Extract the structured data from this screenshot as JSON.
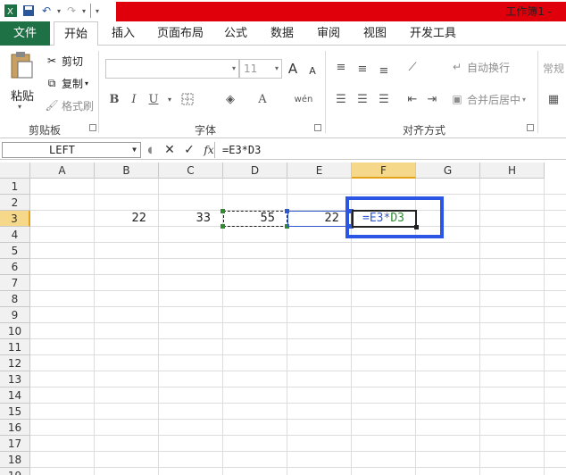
{
  "title_bar": {
    "window_title": "工作簿1 - "
  },
  "tabs": [
    "文件",
    "开始",
    "插入",
    "页面布局",
    "公式",
    "数据",
    "审阅",
    "视图",
    "开发工具"
  ],
  "clipboard": {
    "paste": "粘贴",
    "cut": "剪切",
    "copy": "复制",
    "format_painter": "格式刷",
    "group_label": "剪贴板"
  },
  "font": {
    "font_size": "11",
    "group_label": "字体",
    "bold": "B",
    "italic": "I",
    "underline": "U",
    "grow": "A",
    "shrink": "A"
  },
  "alignment": {
    "wrap": "自动换行",
    "merge": "合并后居中",
    "group_label": "对齐方式"
  },
  "number": {
    "format_value": "常规"
  },
  "formula_bar": {
    "name_box": "LEFT",
    "fx": "fx",
    "formula": "=E3*D3"
  },
  "columns": [
    "A",
    "B",
    "C",
    "D",
    "E",
    "F",
    "G",
    "H"
  ],
  "rows": [
    "1",
    "2",
    "3",
    "4",
    "5",
    "6",
    "7",
    "8",
    "9",
    "10",
    "11",
    "12",
    "13",
    "14",
    "15",
    "16",
    "17",
    "18",
    "19"
  ],
  "cells": {
    "B3": "22",
    "C3": "33",
    "D3": "55",
    "E3": "22",
    "F3_edit_prefix": "=E3*",
    "F3_edit_suffix": "D3"
  },
  "colors": {
    "file_tab": "#1e7145",
    "title_red": "#e0000c",
    "highlight_blue": "#2a55e5",
    "ref_green": "#2e8b2e"
  }
}
